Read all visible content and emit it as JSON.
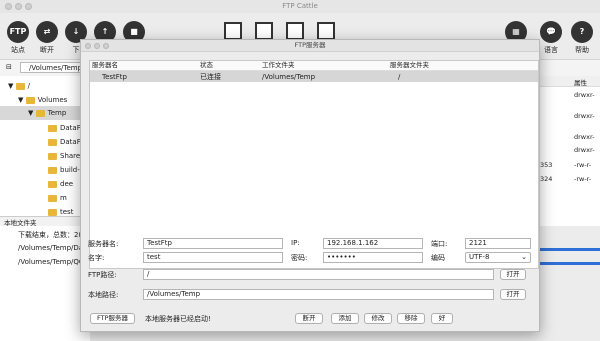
{
  "window": {
    "title": "FTP Cattle"
  },
  "toolbar": {
    "site_label": "站点",
    "disconnect_label": "断开",
    "download_label": "下",
    "ftp_text": "FTP",
    "language_label": "语言",
    "help_label": "帮助"
  },
  "pathbar": {
    "path": "/Volumes/Temp"
  },
  "tree": {
    "items": [
      {
        "label": "/"
      },
      {
        "label": "Volumes"
      },
      {
        "label": "Temp"
      },
      {
        "label": "DataF"
      },
      {
        "label": "DataF"
      },
      {
        "label": "Share"
      },
      {
        "label": "build-"
      },
      {
        "label": "dee"
      },
      {
        "label": "m"
      },
      {
        "label": "test"
      }
    ]
  },
  "local_pane": {
    "title": "本地文件夹"
  },
  "log": {
    "rows": [
      "下载结束，总数：2(",
      "/Volumes/Temp/Da",
      "/Volumes/Temp/QC"
    ]
  },
  "right_pane": {
    "header": "属性",
    "perms": [
      "drwxr-",
      "drwxr-",
      "drwxr-",
      "drwxr-",
      "-rw-r-",
      "-rw-r-"
    ],
    "sizes": [
      "353",
      "324"
    ]
  },
  "dialog": {
    "title": "FTP服务器",
    "columns": [
      "服务器名",
      "状态",
      "工作文件夹",
      "服务器文件夹"
    ],
    "rows": [
      {
        "name": "TestFtp",
        "status": "已连接",
        "work": "/Volumes/Temp",
        "server": "/"
      }
    ],
    "form": {
      "server_name_label": "服务器名:",
      "server_name": "TestFtp",
      "ip_label": "IP:",
      "ip": "192.168.1.162",
      "port_label": "端口:",
      "port": "2121",
      "user_label": "名字:",
      "user": "test",
      "password_label": "密码:",
      "password": "•••••••",
      "encoding_label": "编码",
      "encoding": "UTF-8",
      "ftp_path_label": "FTP路径:",
      "ftp_path": "/",
      "local_path_label": "本地路径:",
      "local_path": "/Volumes/Temp",
      "open_label": "打开"
    },
    "bottom": {
      "ftp_server_button": "FTP服务器",
      "status_text": "本地服务器已经启动!",
      "disconnect": "断开",
      "add": "添加",
      "modify": "修改",
      "remove": "移除",
      "ok": "好"
    }
  }
}
